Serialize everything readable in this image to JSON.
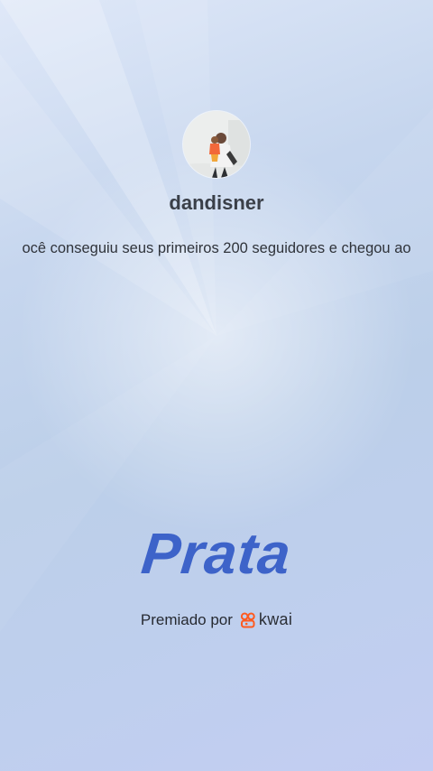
{
  "profile": {
    "username": "dandisner",
    "avatar_icon": "profile-photo-avatar"
  },
  "achievement": {
    "message": "ocê conseguiu seus primeiros 200 seguidores e chegou ao",
    "tier": "Prata"
  },
  "sponsor": {
    "label": "Premiado por",
    "brand": "kwai",
    "brand_color": "#ff5a1f",
    "tier_color": "#3d63c9"
  }
}
